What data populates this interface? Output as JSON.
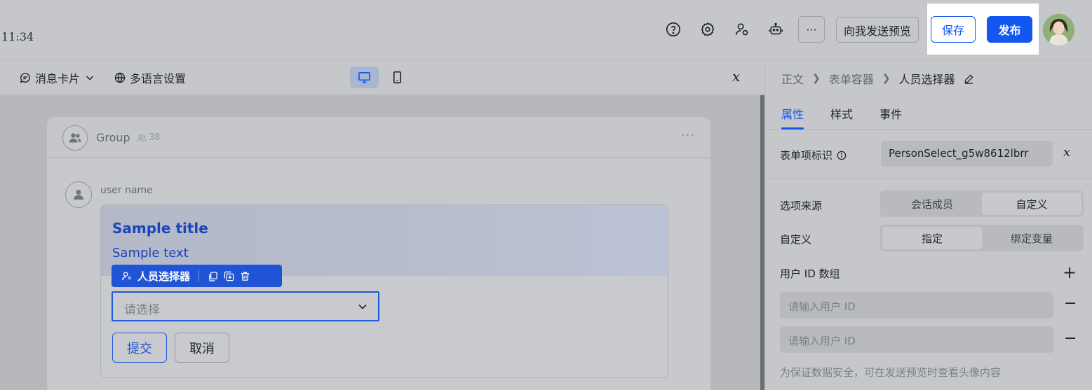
{
  "topbar": {
    "time": "11:34",
    "icons": [
      "help-icon",
      "settings-icon",
      "user-settings-icon",
      "robot-icon"
    ],
    "more_label": "···",
    "preview_label": "向我发送预览",
    "save_label": "保存",
    "publish_label": "发布"
  },
  "editor_toolbar": {
    "message_card_label": "消息卡片",
    "i18n_label": "多语言设置",
    "fx_label": "𝑥"
  },
  "chat": {
    "group_name": "Group",
    "member_count": "38",
    "more_label": "···",
    "user_name": "user name",
    "card": {
      "title": "Sample title",
      "text": "Sample text",
      "component_tag": "人员选择器",
      "select_placeholder": "请选择",
      "submit_label": "提交",
      "cancel_label": "取消"
    }
  },
  "panel": {
    "breadcrumb": [
      "正文",
      "表单容器",
      "人员选择器"
    ],
    "tabs": [
      "属性",
      "样式",
      "事件"
    ],
    "active_tab": "属性",
    "form_id_label": "表单项标识",
    "form_id_value": "PersonSelect_g5w8612lbrr",
    "fx_label": "𝑥",
    "source_label": "选项来源",
    "source_options": [
      "会话成员",
      "自定义"
    ],
    "source_selected": "自定义",
    "custom_label": "自定义",
    "custom_options": [
      "指定",
      "绑定变量"
    ],
    "custom_selected": "指定",
    "uid_label": "用户 ID 数组",
    "uid_placeholder_1": "请输入用户 ID",
    "uid_placeholder_2": "请输入用户 ID",
    "hint": "为保证数据安全，可在发送预览时查看头像内容"
  },
  "colors": {
    "accent": "#1456f0",
    "card_blue": "#1f54d6"
  }
}
